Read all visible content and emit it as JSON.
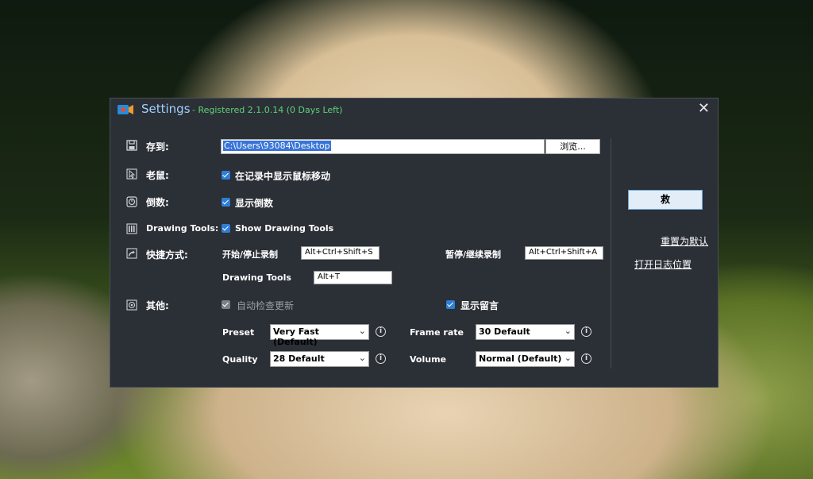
{
  "window": {
    "title": "Settings",
    "registration": "- Registered 2.1.0.14 (0 Days Left)",
    "close_glyph": "✕"
  },
  "save_to": {
    "label": "存到:",
    "path_value": "C:\\Users\\93084\\Desktop",
    "browse_label": "浏览..."
  },
  "mouse": {
    "label": "老鼠:",
    "checkbox_label": "在记录中显示鼠标移动",
    "checked": true
  },
  "countdown": {
    "label": "倒数:",
    "checkbox_label": "显示倒数",
    "checked": true
  },
  "drawing_tools": {
    "label": "Drawing Tools:",
    "checkbox_label": "Show Drawing Tools",
    "checked": true
  },
  "hotkeys": {
    "label": "快捷方式:",
    "start_stop_label": "开始/停止录制",
    "start_stop_value": "Alt+Ctrl+Shift+S",
    "pause_resume_label": "暂停/继续录制",
    "pause_resume_value": "Alt+Ctrl+Shift+A",
    "drawing_tools_label": "Drawing Tools",
    "drawing_tools_value": "Alt+T"
  },
  "other": {
    "label": "其他:",
    "auto_update_label": "自动检查更新",
    "auto_update_checked": true,
    "auto_update_disabled": true,
    "show_comments_label": "显示留言",
    "show_comments_checked": true,
    "preset_label": "Preset",
    "preset_value": "Very Fast (Default)",
    "framerate_label": "Frame rate",
    "framerate_value": "30 Default",
    "quality_label": "Quality",
    "quality_value": "28 Default",
    "volume_label": "Volume",
    "volume_value": "Normal (Default)"
  },
  "actions": {
    "save_label": "救",
    "reset_label": "重置为默认",
    "open_log_label": "打开日志位置"
  },
  "colors": {
    "dialog_bg": "#2b2f36",
    "title_text": "#9fd0ff",
    "registration_text": "#5fd37a",
    "checkbox_accent": "#2f7ed8",
    "selection": "#3874d8"
  }
}
